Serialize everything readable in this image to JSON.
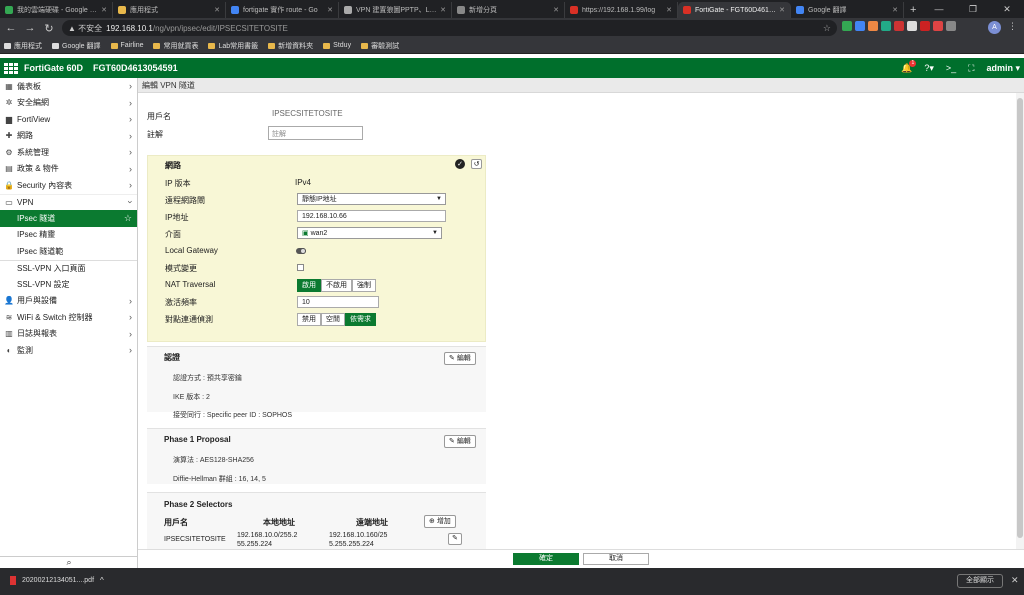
{
  "browser": {
    "tabs": [
      {
        "title": "我的雲端硬碟 - Google 雲端",
        "color": "#34a853"
      },
      {
        "title": "應用程式",
        "color": "#e8b84b"
      },
      {
        "title": "fortigate 實作 route - Go",
        "color": "#4285f4"
      },
      {
        "title": "VPN 建置狼圖PPTP、L2T",
        "color": "#aaaaaa"
      },
      {
        "title": "新增分頁",
        "color": "#888888"
      },
      {
        "title": "https://192.168.1.99/log",
        "color": "#d93025"
      },
      {
        "title": "FortiGate - FGT60D4613054591",
        "color": "#d93025",
        "active": true
      },
      {
        "title": "Google 翻譯",
        "color": "#4285f4"
      }
    ],
    "new_tab": "+",
    "nav": {
      "back": "←",
      "forward": "→",
      "reload": "↻"
    },
    "address": {
      "warning": "▲ 不安全",
      "host": "192.168.10.1",
      "path": "/ng/vpn/ipsec/edit/IPSECSITETOSITE"
    },
    "avatar": "A",
    "bookmarks": [
      "應用程式",
      "Google 翻譯",
      "Fairline",
      "常用就買表",
      "Lab常用書籤",
      "新增資料夾",
      "Stduy",
      "審驗測試"
    ]
  },
  "fortigate": {
    "model": "FortiGate 60D",
    "serial": "FGT60D4613054591",
    "notif_count": "1",
    "user": "admin"
  },
  "sidebar": {
    "items": [
      {
        "icon": "▦",
        "label": "儀表板"
      },
      {
        "icon": "✲",
        "label": "安全編網"
      },
      {
        "icon": "▆",
        "label": "FortiView"
      },
      {
        "icon": "✚",
        "label": "網路"
      },
      {
        "icon": "⚙",
        "label": "系統管理"
      },
      {
        "icon": "▤",
        "label": "政策 & 物件"
      },
      {
        "icon": "🔒",
        "label": "Security 內容表"
      }
    ],
    "vpn": {
      "icon": "▭",
      "label": "VPN"
    },
    "vpn_sub": [
      "IPsec 隧道",
      "IPsec 精靈",
      "IPsec 隧道範",
      "SSL-VPN 入口頁面",
      "SSL-VPN 設定"
    ],
    "items2": [
      {
        "icon": "👤",
        "label": "用戶與設備"
      },
      {
        "icon": "≋",
        "label": "WiFi & Switch 控制器"
      },
      {
        "icon": "▥",
        "label": "日誌與報表"
      },
      {
        "icon": "◐",
        "label": "監測"
      }
    ]
  },
  "breadcrumb": "編輯 VPN 隧道",
  "form": {
    "name_label": "用戶名",
    "name_value": "IPSECSITETOSITE",
    "comment_label": "註解",
    "comment_placeholder": "註解"
  },
  "network": {
    "title": "網路",
    "ip_version_label": "IP 版本",
    "ip_version_value": "IPv4",
    "remote_gw_label": "遠程網路閘",
    "remote_gw_value": "靜態IP地址",
    "ip_label": "IP地址",
    "ip_value": "192.168.10.66",
    "interface_label": "介面",
    "interface_value": "wan2",
    "local_gw_label": "Local Gateway",
    "mode_cfg_label": "模式變更",
    "nat_label": "NAT Traversal",
    "nat_options": [
      "啟用",
      "不啟用",
      "強制"
    ],
    "keepalive_label": "激活頻率",
    "keepalive_value": "10",
    "dpd_label": "對點連通偵測",
    "dpd_options": [
      "禁用",
      "空閒",
      "依需求"
    ]
  },
  "auth": {
    "title": "認證",
    "edit_label": "編輯",
    "method": "認證方式 : 預共享密鑰",
    "ike": "IKE 版本 : 2",
    "peer": "接受同行 : Specific peer ID : SOPHOS"
  },
  "phase1": {
    "title": "Phase 1 Proposal",
    "edit_label": "編輯",
    "encryption": "演算法 : AES128-SHA256",
    "dh": "Diffie-Hellman 群組 : 16, 14, 5"
  },
  "phase2": {
    "title": "Phase 2 Selectors",
    "add_label": "增加",
    "col_name": "用戶名",
    "col_local": "本地地址",
    "col_remote": "遠端地址",
    "row": {
      "name": "IPSECSITETOSITE",
      "local": "192.168.10.0/255.255.255.224",
      "remote": "192.168.10.160/255.255.255.224"
    }
  },
  "footer": {
    "ok": "確定",
    "cancel": "取消"
  },
  "downloads": {
    "file": "20200212134051....pdf",
    "show_all": "全部顯示"
  }
}
